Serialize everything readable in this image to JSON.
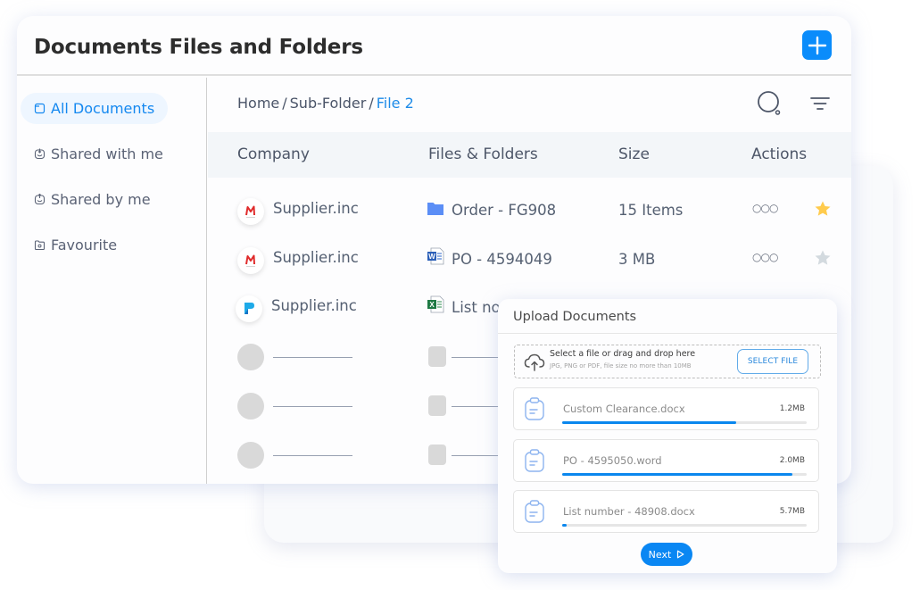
{
  "header": {
    "title": "Documents Files and Folders",
    "add_icon": "plus-icon"
  },
  "sidebar": {
    "items": [
      {
        "label": "All Documents",
        "icon": "document-icon",
        "active": true
      },
      {
        "label": "Shared with me",
        "icon": "inbox-download-icon",
        "active": false
      },
      {
        "label": "Shared by me",
        "icon": "inbox-upload-icon",
        "active": false
      },
      {
        "label": "Favourite",
        "icon": "folder-heart-icon",
        "active": false
      }
    ]
  },
  "breadcrumb": {
    "items": [
      "Home",
      "Sub-Folder",
      "File 2"
    ],
    "separator": "/"
  },
  "toolbar": {
    "search_icon": "search-icon",
    "filter_icon": "filter-icon"
  },
  "table": {
    "columns": [
      "Company",
      "Files & Folders",
      "Size",
      "Actions"
    ],
    "rows": [
      {
        "company": "Supplier.inc",
        "logo": "red-m-logo",
        "file": "Order - FG908",
        "file_type": "folder-icon",
        "size": "15 Items",
        "actions": "•••",
        "starred": true
      },
      {
        "company": "Supplier.inc",
        "logo": "red-m-logo",
        "file": "PO - 4594049",
        "file_type": "word-file-icon",
        "size": "3 MB",
        "actions": "•••",
        "starred": false
      },
      {
        "company": "Supplier.inc",
        "logo": "blue-p-logo",
        "file": "List no",
        "file_type": "excel-file-icon",
        "size": "",
        "actions": "",
        "starred": null
      }
    ],
    "placeholder_rows": 3
  },
  "upload": {
    "title": "Upload Documents",
    "dropzone": {
      "main_text": "Select a file or drag and drop here",
      "sub_text": "JPG, PNG or PDF, file size no more than 10MB",
      "button_label": "SELECT FILE"
    },
    "files": [
      {
        "name": "Custom Clearance.docx",
        "size": "1.2MB",
        "progress": 0.71
      },
      {
        "name": "PO - 4595050.word",
        "size": "2.0MB",
        "progress": 0.94
      },
      {
        "name": "List number - 48908.docx",
        "size": "5.7MB",
        "progress": 0.02
      }
    ],
    "next_label": "Next"
  },
  "colors": {
    "accent": "#0a8cfb",
    "active_text": "#1488f0",
    "star_on": "#ffcb4d",
    "star_off": "#d3dadf",
    "folder": "#5b8ef6"
  }
}
